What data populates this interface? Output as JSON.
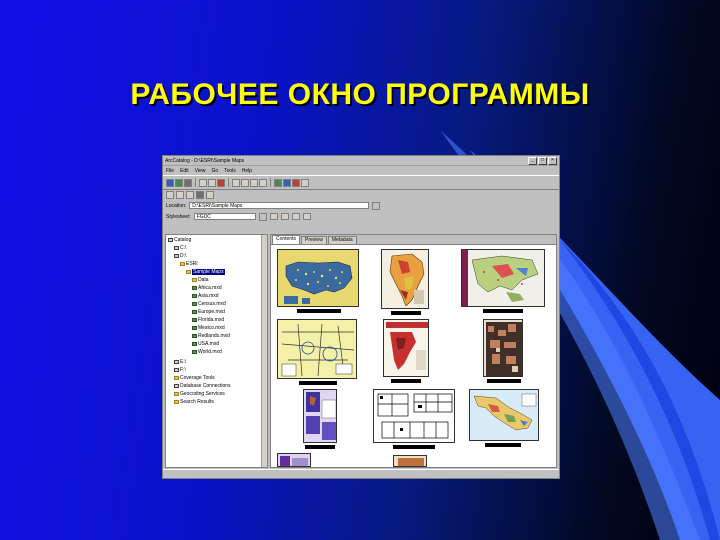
{
  "slide": {
    "title": "РАБОЧЕЕ ОКНО ПРОГРАММЫ",
    "title_color": "#ffff00"
  },
  "window": {
    "title": "ArcCatalog - D:\\ESRI\\Sample Maps",
    "menus": [
      "File",
      "Edit",
      "View",
      "Go",
      "Tools",
      "Help"
    ],
    "location_label": "Location:",
    "location_value": "D:\\ESRI\\Sample Maps",
    "stylesheet_label": "Stylesheet:",
    "stylesheet_value": "FGDC",
    "tabs": [
      "Contents",
      "Preview",
      "Metadata"
    ],
    "active_tab": "Contents",
    "tree": {
      "root": "Catalog",
      "selected": "Sample Maps",
      "items": [
        "Catalog",
        "C:\\",
        "D:\\",
        "ESRI",
        "Sample Maps",
        "Data",
        "Africa.mxd",
        "Asia.mxd",
        "Census.mxd",
        "Europe.mxd",
        "Florida.mxd",
        "Mexico.mxd",
        "Redlands.mxd",
        "USA.mxd",
        "World.mxd",
        "E:\\",
        "F:\\",
        "Coverage Tools",
        "Database Connections",
        "Geocoding Services",
        "Search Results"
      ]
    },
    "thumbnails": [
      {
        "name": "usa-map"
      },
      {
        "name": "africa-map"
      },
      {
        "name": "asia-map"
      },
      {
        "name": "transport-map"
      },
      {
        "name": "florida-map"
      },
      {
        "name": "census-map"
      },
      {
        "name": "pacific-map"
      },
      {
        "name": "floorplan-map"
      },
      {
        "name": "mexico-map"
      }
    ]
  }
}
